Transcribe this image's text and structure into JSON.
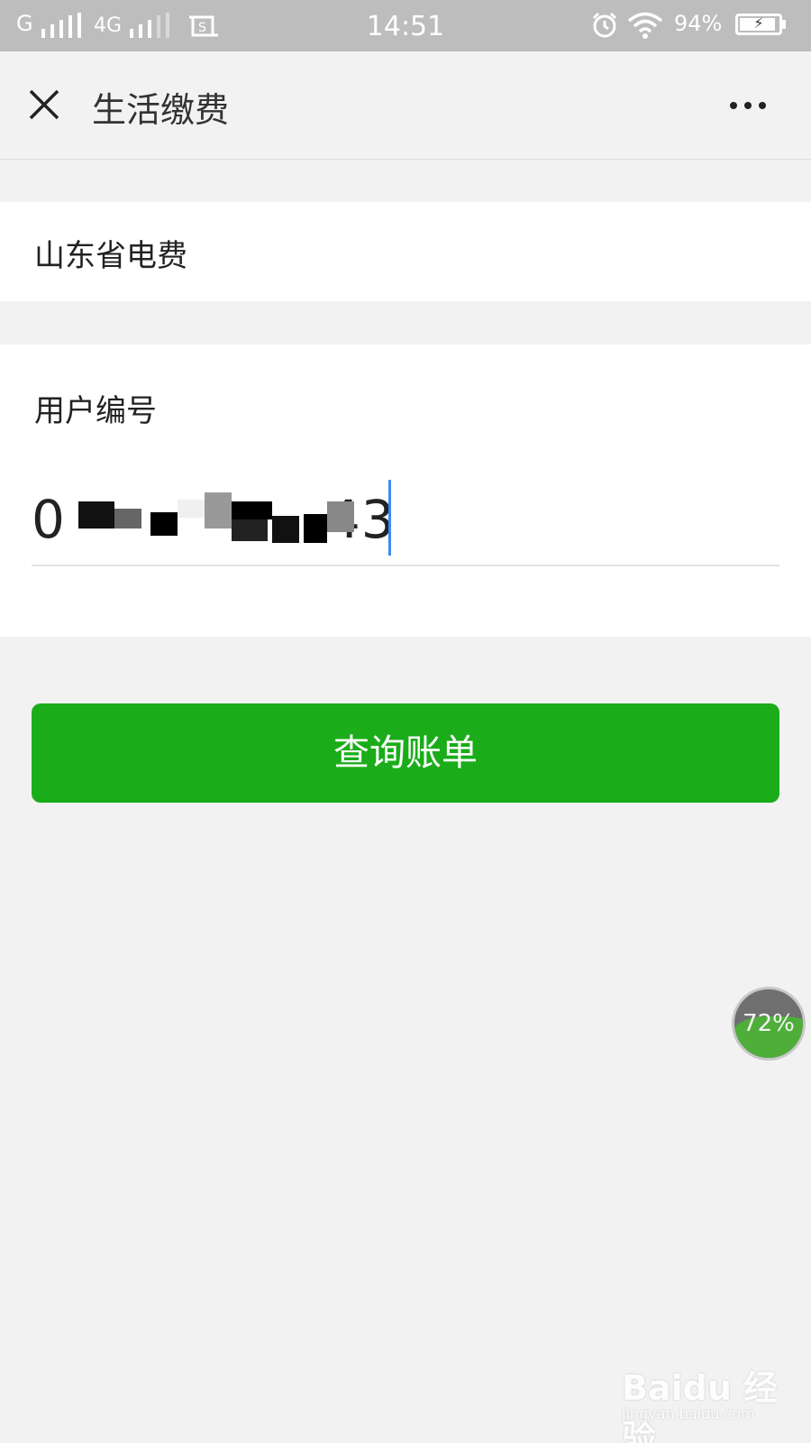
{
  "status_bar": {
    "carrier1": "G",
    "carrier2": "4G",
    "time": "14:51",
    "battery_percent": "94%",
    "battery_level": 0.94
  },
  "header": {
    "title": "生活缴费"
  },
  "province": {
    "label": "山东省电费"
  },
  "account": {
    "label": "用户编号",
    "value_prefix": "0",
    "value_suffix": "43"
  },
  "query_button": {
    "label": "查询账单"
  },
  "float_badge": {
    "percent": "72%"
  },
  "watermark": {
    "brand": "Baidu 经验",
    "url": "jingyan.baidu.com"
  },
  "colors": {
    "primary_green": "#1aad19",
    "caret_blue": "#3d8bf0",
    "status_bar_bg": "#bdbdbd"
  }
}
